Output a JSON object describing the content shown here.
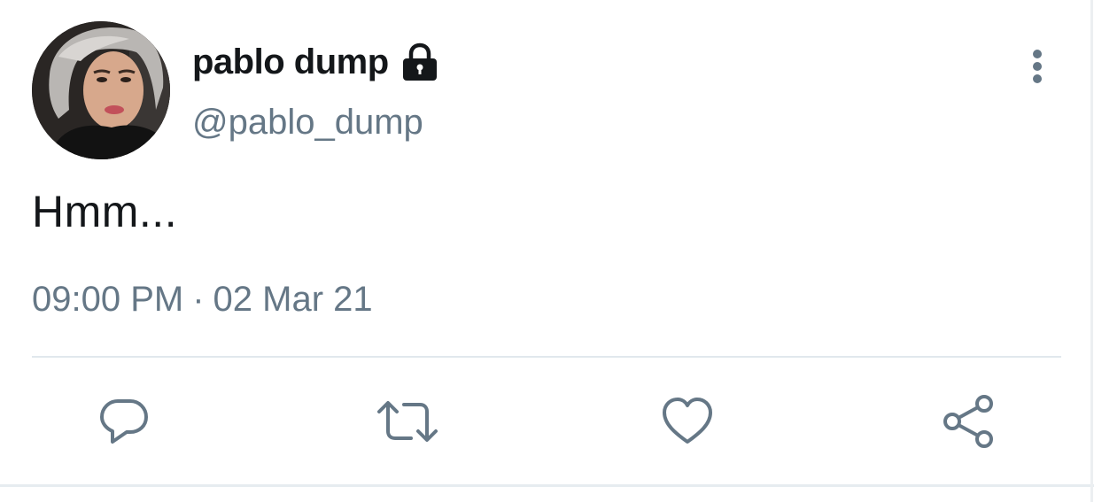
{
  "user": {
    "display_name": "pablo dump",
    "handle": "@pablo_dump",
    "protected_icon": "lock-icon",
    "avatar": "profile-photo"
  },
  "tweet": {
    "text": "Hmm...",
    "time": "09:00 PM",
    "separator": "·",
    "date": "02 Mar 21"
  },
  "menu": {
    "icon": "vertical-ellipsis-icon"
  },
  "actions": [
    {
      "name": "reply",
      "icon": "speech-bubble-icon"
    },
    {
      "name": "retweet",
      "icon": "retweet-icon"
    },
    {
      "name": "like",
      "icon": "heart-icon"
    },
    {
      "name": "share",
      "icon": "share-icon"
    }
  ],
  "colors": {
    "text_primary": "#14171a",
    "text_secondary": "#657786",
    "icon": "#657786",
    "divider": "#e1e8ed"
  }
}
